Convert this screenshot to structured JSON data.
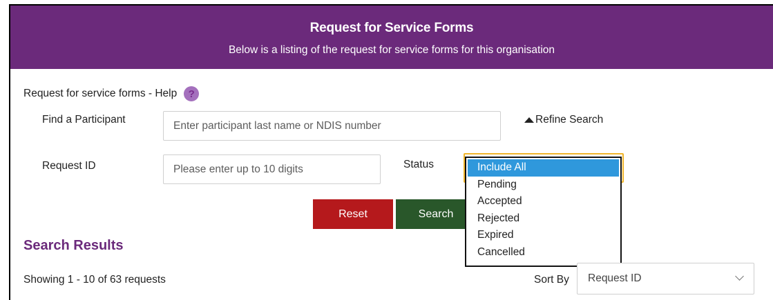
{
  "header": {
    "title": "Request for Service Forms",
    "subtitle": "Below is a listing of the request for service forms for this organisation"
  },
  "help": {
    "label": "Request for service forms - Help",
    "icon": "question-icon",
    "glyph": "?"
  },
  "search": {
    "participant_label": "Find a Participant",
    "participant_placeholder": "Enter participant last name or NDIS number",
    "refine_label": "Refine Search",
    "request_id_label": "Request ID",
    "request_id_placeholder": "Please enter up to 10 digits",
    "status_label": "Status",
    "status_options": [
      "Include All",
      "Pending",
      "Accepted",
      "Rejected",
      "Expired",
      "Cancelled"
    ],
    "status_selected": "Include All",
    "reset_label": "Reset",
    "search_label": "Search"
  },
  "results": {
    "title": "Search Results",
    "showing": "Showing 1 - 10 of 63 requests",
    "sort_label": "Sort By",
    "sort_value": "Request ID"
  },
  "colors": {
    "header_bg": "#6b2a7b",
    "reset_bg": "#b5191c",
    "search_bg": "#29572a",
    "selected_option_bg": "#2f98dc",
    "focus_border": "#f0b429"
  }
}
